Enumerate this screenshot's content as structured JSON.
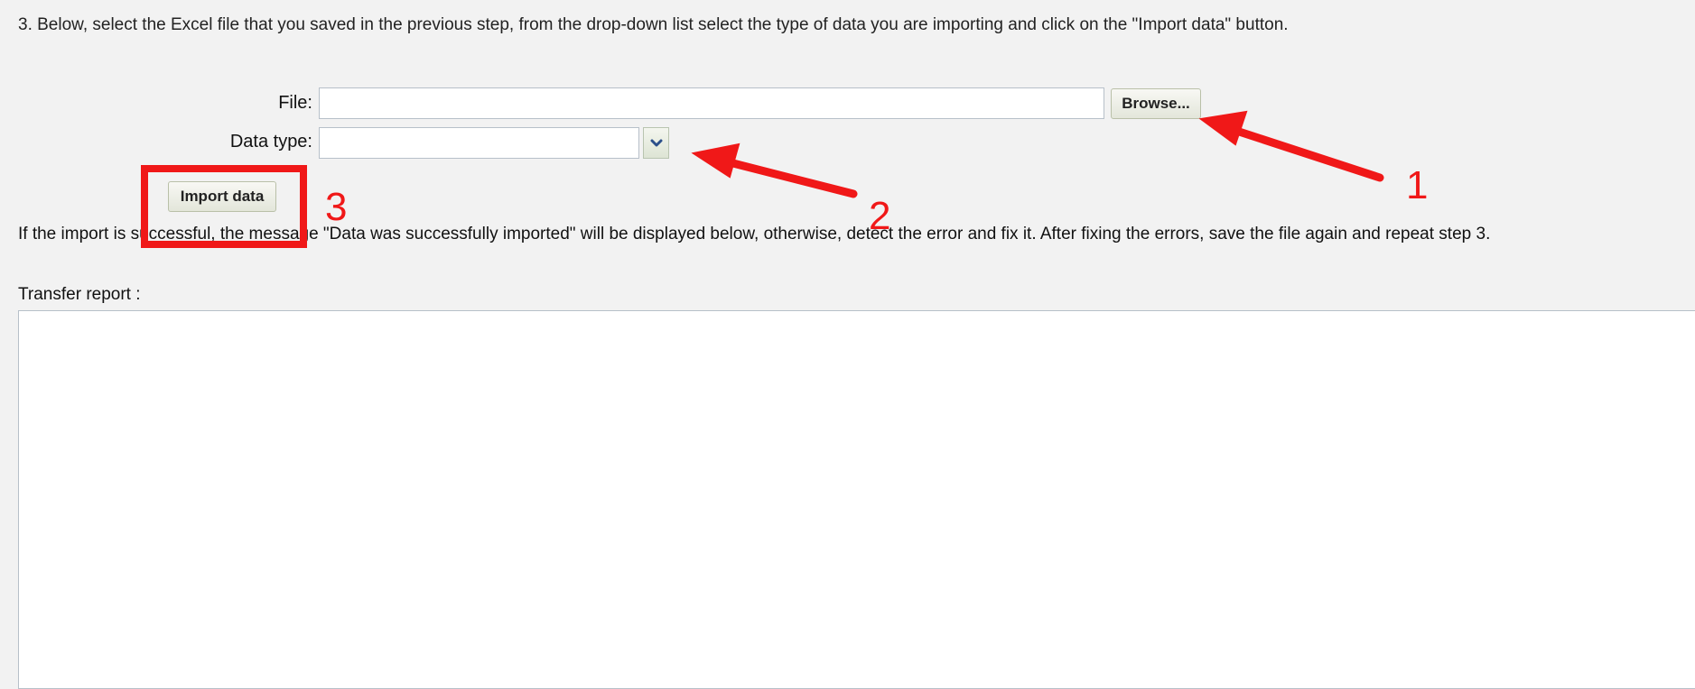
{
  "instructions": {
    "step3": "3. Below, select the Excel file that you saved in the previous step, from the drop-down list select the type of data you are importing and click on the \"Import data\" button.",
    "result_info": "If the import is successful, the message \"Data was successfully imported\" will be displayed below, otherwise, detect the error and fix it. After fixing the errors, save the file again and repeat step 3."
  },
  "form": {
    "file_label": "File:",
    "file_value": "",
    "browse_label": "Browse...",
    "data_type_label": "Data type:",
    "data_type_value": "",
    "import_label": "Import data"
  },
  "report": {
    "label": "Transfer report :",
    "content": ""
  },
  "annotations": {
    "color": "#f01818",
    "markers": [
      "1",
      "2",
      "3"
    ]
  }
}
